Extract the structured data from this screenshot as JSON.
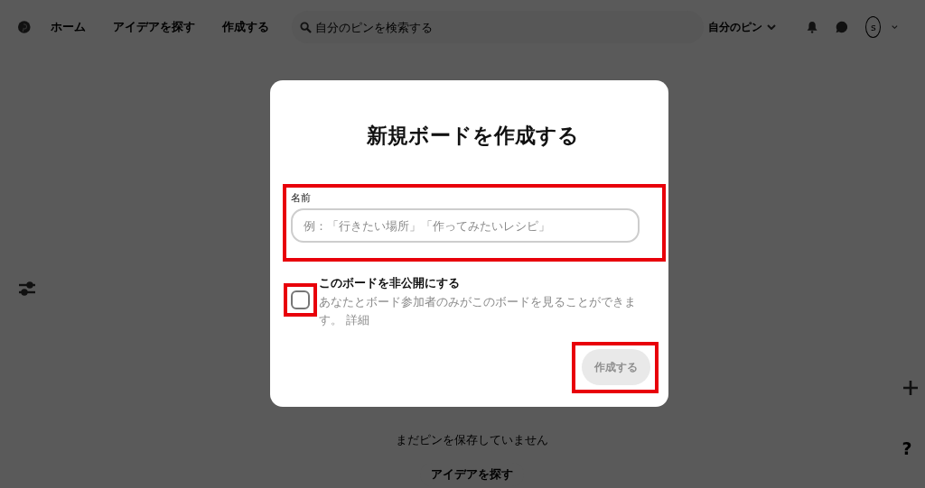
{
  "header": {
    "nav": [
      {
        "label": "ホーム"
      },
      {
        "label": "アイデアを探す"
      },
      {
        "label": "作成する"
      }
    ],
    "search": {
      "placeholder": "自分のピンを検索する"
    },
    "pins_menu": {
      "label": "自分のピン"
    },
    "avatar": {
      "initial": "s"
    }
  },
  "background": {
    "empty_message": "まだピンを保存していません",
    "explore_button": "アイデアを探す",
    "help": "?"
  },
  "dialog": {
    "title": "新規ボードを作成する",
    "name_field": {
      "label": "名前",
      "placeholder": "例：「行きたい場所」「作ってみたいレシピ」",
      "highlighted": true
    },
    "secret": {
      "label": "このボードを非公開にする",
      "description": "あなたとボード参加者のみがこのボードを見ることができます。",
      "link": "詳細",
      "checked": false,
      "highlighted": true
    },
    "create_button": {
      "label": "作成する",
      "disabled": true,
      "highlighted": true
    }
  }
}
